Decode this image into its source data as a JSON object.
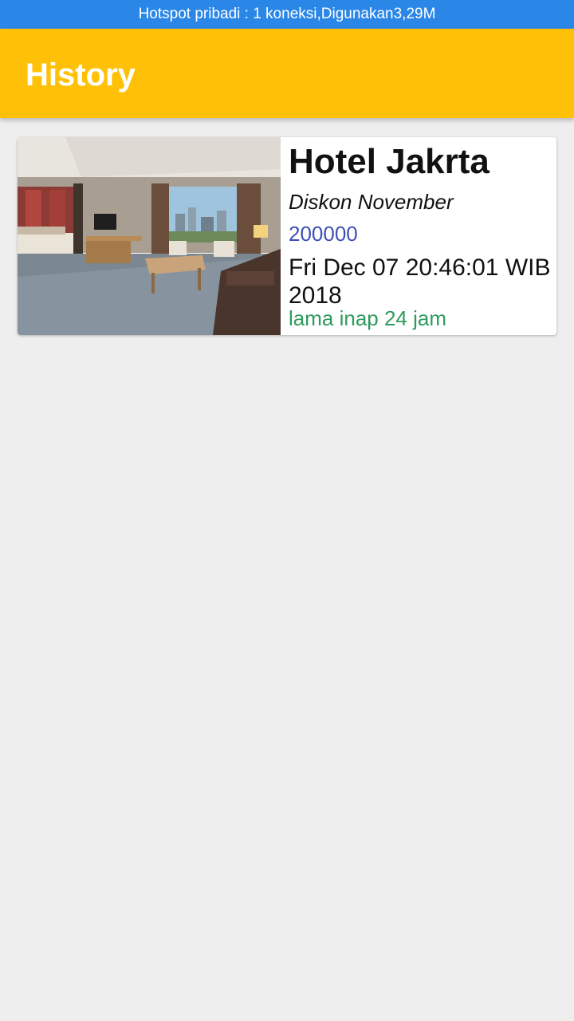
{
  "status_bar": {
    "text": "Hotspot pribadi : 1 koneksi,Digunakan3,29M"
  },
  "app_bar": {
    "title": "History"
  },
  "history": {
    "items": [
      {
        "name": "Hotel Jakrta",
        "promo": "Diskon November",
        "price": "200000",
        "date": "Fri Dec 07 20:46:01 WIB 2018",
        "duration": "lama inap 24 jam"
      }
    ]
  },
  "colors": {
    "status_bar": "#2a87e8",
    "app_bar": "#ffc107",
    "background": "#eeeeee",
    "price": "#3f51b5",
    "duration": "#2e9a5c"
  }
}
